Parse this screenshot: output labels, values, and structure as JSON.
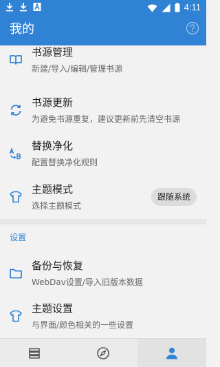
{
  "status_bar": {
    "time": "4:11",
    "left_icons": [
      "download-icon",
      "download-icon",
      "font-icon"
    ],
    "right_icons": [
      "wifi-icon",
      "signal-icon",
      "battery-icon"
    ]
  },
  "app_bar": {
    "title": "我的",
    "action_icon": "help-icon"
  },
  "menu": {
    "items": [
      {
        "icon": "book-icon",
        "title": "书源管理",
        "subtitle": "新建/导入/编辑/管理书源"
      },
      {
        "icon": "sync-icon",
        "title": "书源更新",
        "subtitle": "为避免书源重复，建议更新前先清空书源"
      },
      {
        "icon": "replace-icon",
        "title": "替换净化",
        "subtitle": "配置替换净化规则"
      },
      {
        "icon": "shirt-icon",
        "title": "主题模式",
        "subtitle": "选择主题模式",
        "value": "跟随系统"
      }
    ]
  },
  "settings": {
    "section_title": "设置",
    "items": [
      {
        "icon": "folder-icon",
        "title": "备份与恢复",
        "subtitle": "WebDav设置/导入旧版本数据"
      },
      {
        "icon": "shirt-icon",
        "title": "主题设置",
        "subtitle": "与界面/颜色相关的一些设置"
      }
    ]
  },
  "bottom_nav": {
    "tabs": [
      {
        "icon": "bookshelf-icon",
        "active": false
      },
      {
        "icon": "compass-icon",
        "active": false
      },
      {
        "icon": "person-icon",
        "active": true
      }
    ]
  },
  "colors": {
    "primary": "#2f82d4",
    "background": "#f2f2f2",
    "text_primary": "#222222",
    "text_secondary": "#666666"
  }
}
